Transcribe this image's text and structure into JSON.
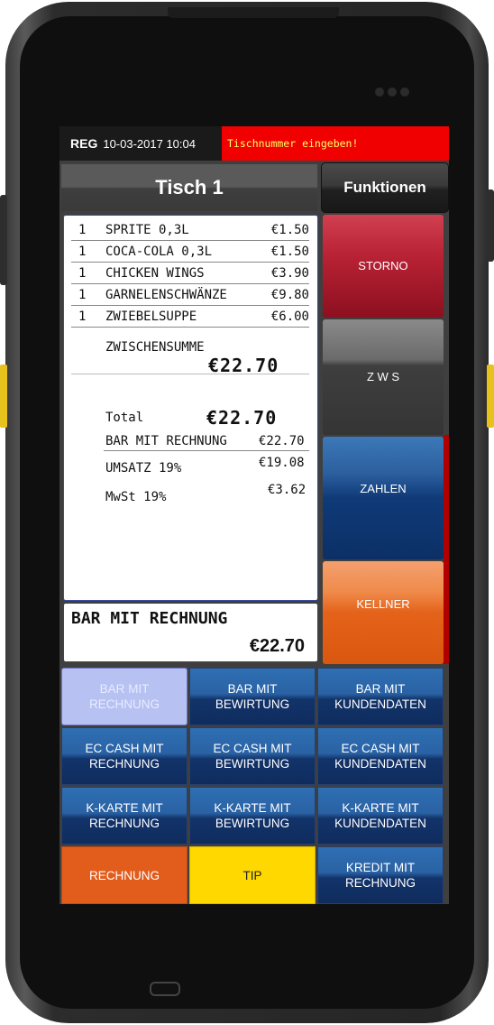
{
  "status": {
    "app": "REG",
    "datetime": "10-03-2017 10:04",
    "alert": "Tischnummer eingeben!"
  },
  "header": {
    "table_title": "Tisch 1",
    "functions_label": "Funktionen"
  },
  "receipt": {
    "items": [
      {
        "qty": "1",
        "name": "SPRITE 0,3L",
        "price": "€1.50"
      },
      {
        "qty": "1",
        "name": "COCA-COLA 0,3L",
        "price": "€1.50"
      },
      {
        "qty": "1",
        "name": "CHICKEN WINGS",
        "price": "€3.90"
      },
      {
        "qty": "1",
        "name": "GARNELENSCHWÄNZE",
        "price": "€9.80"
      },
      {
        "qty": "1",
        "name": "ZWIEBELSUPPE",
        "price": "€6.00"
      }
    ],
    "subtotal_label": "ZWISCHENSUMME",
    "subtotal_value": "€22.70",
    "total_label": "Total",
    "total_value": "€22.70",
    "payment_label": "BAR MIT RECHNUNG",
    "payment_value": "€22.70",
    "revenue_label": "UMSATZ 19%",
    "revenue_value": "€19.08",
    "vat_label": "MwSt 19%",
    "vat_value": "€3.62"
  },
  "summary": {
    "label": "BAR MIT RECHNUNG",
    "amount": "€22.70"
  },
  "side_actions": [
    {
      "label": "STORNO",
      "color": "#a81c28"
    },
    {
      "label": "Z W S",
      "color": "#3c3c3c"
    },
    {
      "label": "ZAHLEN",
      "color": "#0f3a78"
    },
    {
      "label": "KELLNER",
      "color": "#e4621a"
    }
  ],
  "payment_buttons": [
    {
      "line1": "BAR MIT",
      "line2": "RECHNUNG",
      "selected": true
    },
    {
      "line1": "BAR MIT",
      "line2": "BEWIRTUNG"
    },
    {
      "line1": "BAR MIT",
      "line2": "KUNDENDATEN"
    },
    {
      "line1": "EC CASH MIT",
      "line2": "RECHNUNG"
    },
    {
      "line1": "EC CASH MIT",
      "line2": "BEWIRTUNG"
    },
    {
      "line1": "EC CASH MIT",
      "line2": "KUNDENDATEN"
    },
    {
      "line1": "K-KARTE MIT",
      "line2": "RECHNUNG"
    },
    {
      "line1": "K-KARTE MIT",
      "line2": "BEWIRTUNG"
    },
    {
      "line1": "K-KARTE MIT",
      "line2": "KUNDENDATEN"
    },
    {
      "line1": "RECHNUNG",
      "line2": "",
      "color": "#e25d1c"
    },
    {
      "line1": "TIP",
      "line2": "",
      "color": "#ffd800"
    },
    {
      "line1": "KREDIT MIT",
      "line2": "RECHNUNG"
    }
  ]
}
